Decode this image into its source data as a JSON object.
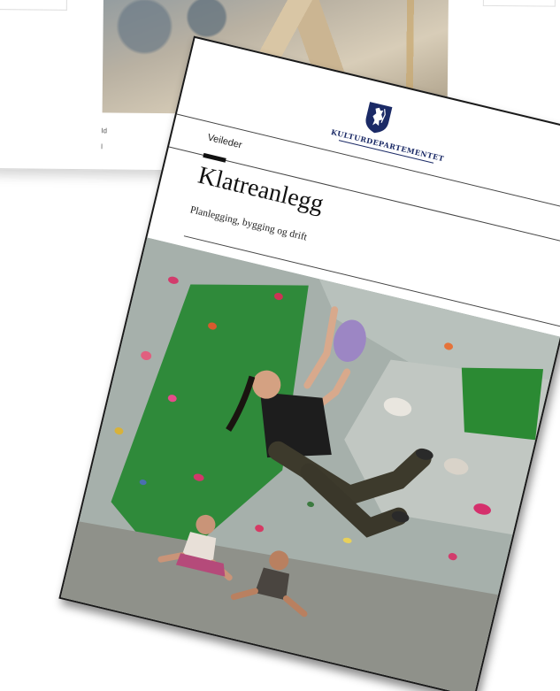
{
  "background_page": {
    "caption_line_1": "Id",
    "caption_line_2": "l"
  },
  "cover": {
    "ministry": "KULTURDEPARTEMENTET",
    "doc_type": "Veileder",
    "title": "Klatreanlegg",
    "subtitle": "Planlegging, bygging og drift"
  },
  "colors": {
    "ministry_blue": "#1b2a66",
    "wall_green": "#2f8a3a",
    "wall_gray": "#a9b3ae",
    "hold_purple": "#9c86c4"
  },
  "icons": {
    "logo": "norwegian-coat-of-arms-icon"
  }
}
